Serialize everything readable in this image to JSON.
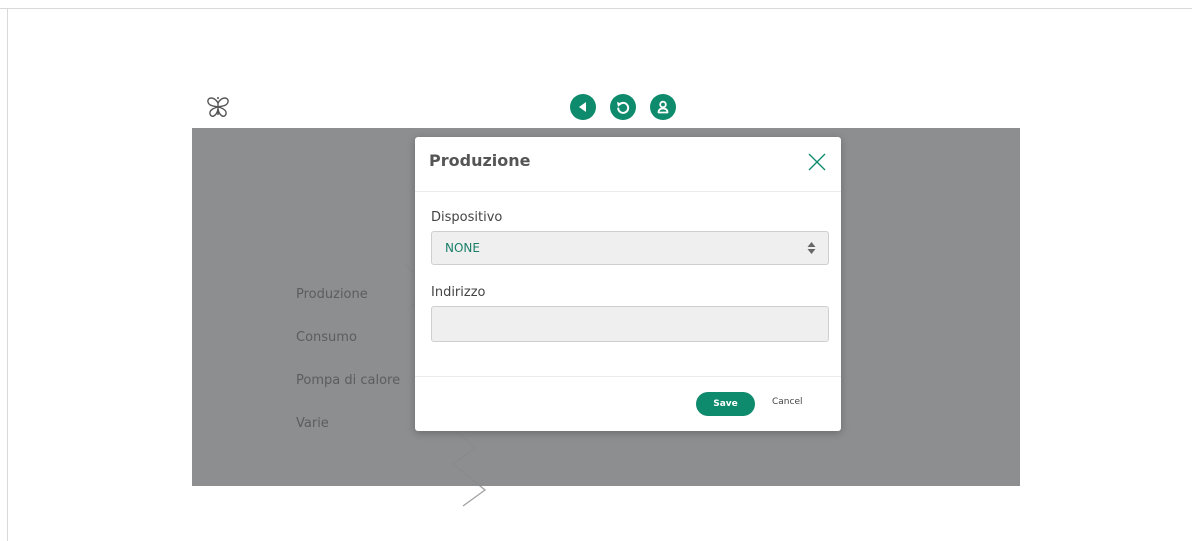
{
  "header": {
    "logo_icon": "butterfly-icon",
    "nav_icons": [
      "arrow-left-icon",
      "refresh-icon",
      "user-icon"
    ],
    "accent_color": "#0e8a6c"
  },
  "sidebar": {
    "items": [
      {
        "label": "Produzione"
      },
      {
        "label": "Consumo"
      },
      {
        "label": "Pompa di calore"
      },
      {
        "label": "Varie"
      }
    ]
  },
  "modal": {
    "title": "Produzione",
    "close_icon": "close-icon",
    "device_label": "Dispositivo",
    "device_value": "NONE",
    "address_label": "Indirizzo",
    "address_value": "",
    "save_label": "Save",
    "cancel_label": "Cancel"
  }
}
